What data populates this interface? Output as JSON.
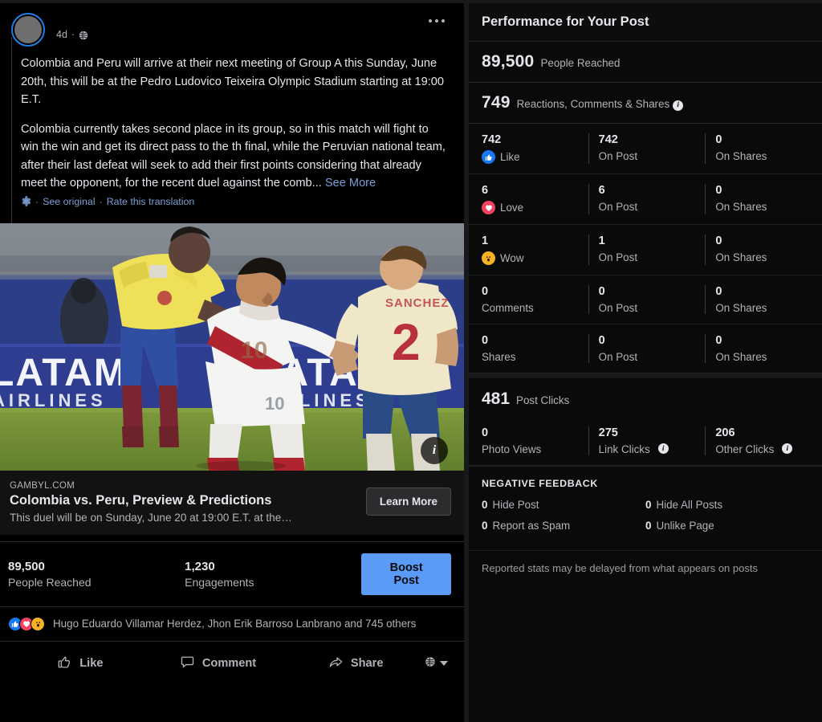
{
  "post": {
    "timestamp": "4d",
    "privacy_icon": "globe-icon",
    "menu_icon": "ellipsis-icon",
    "paragraphs": [
      "Colombia and Peru will arrive at their next meeting of Group A this Sunday, June 20th, this will be at the Pedro Ludovico Teixeira Olympic Stadium starting at 19:00 E.T.",
      "Colombia currently takes second place in its group, so in this match will fight to win the win and get its direct pass to the th final, while the Peruvian national team, after their last defeat will seek to add their first points considering that already meet the opponent, for the recent duel against the comb..."
    ],
    "see_more": "See More",
    "translation": {
      "gear_icon": "gear-icon",
      "separator": "·",
      "see_original": "See original",
      "rate": "Rate this translation"
    },
    "photo": {
      "alt": "Colombia vs Peru football match photo",
      "info_badge": "i",
      "banner_text": "LATAM AIRLINES",
      "jersey_number": "2",
      "jersey_name": "SANCHEZ",
      "peru_number": "10"
    },
    "link_card": {
      "domain": "GAMBYL.COM",
      "title": "Colombia vs. Peru, Preview & Predictions",
      "description": "This duel will be on Sunday, June 20 at 19:00 E.T. at the…",
      "cta": "Learn More"
    },
    "engagement": {
      "reach_value": "89,500",
      "reach_label": "People Reached",
      "engagements_value": "1,230",
      "engagements_label": "Engagements",
      "boost_label": "Boost Post"
    },
    "reactions_summary": {
      "badges": [
        "like-reaction-icon",
        "love-reaction-icon",
        "wow-reaction-icon"
      ],
      "names": "Hugo Eduardo Villamar Herdez, Jhon Erik Barroso Lanbrano and 745 others"
    },
    "actions": [
      {
        "label": "Like",
        "icon": "thumbs-up-icon"
      },
      {
        "label": "Comment",
        "icon": "comment-bubble-icon"
      },
      {
        "label": "Share",
        "icon": "share-arrow-icon"
      }
    ],
    "audience": {
      "icon": "globe-icon",
      "caret": "chevron-down-icon"
    }
  },
  "insights": {
    "title": "Performance for Your Post",
    "summary": [
      {
        "value": "89,500",
        "label": "People Reached",
        "info": false
      },
      {
        "value": "749",
        "label": "Reactions, Comments & Shares",
        "info": true
      }
    ],
    "breakdown_rows": [
      {
        "icon": "like-reaction-icon",
        "total": "742",
        "type": "Like",
        "on_post": "742",
        "on_post_label": "On Post",
        "on_shares": "0",
        "on_shares_label": "On Shares"
      },
      {
        "icon": "love-reaction-icon",
        "total": "6",
        "type": "Love",
        "on_post": "6",
        "on_post_label": "On Post",
        "on_shares": "0",
        "on_shares_label": "On Shares"
      },
      {
        "icon": "wow-reaction-icon",
        "total": "1",
        "type": "Wow",
        "on_post": "1",
        "on_post_label": "On Post",
        "on_shares": "0",
        "on_shares_label": "On Shares"
      },
      {
        "icon": "",
        "total": "0",
        "type": "Comments",
        "on_post": "0",
        "on_post_label": "On Post",
        "on_shares": "0",
        "on_shares_label": "On Shares"
      },
      {
        "icon": "",
        "total": "0",
        "type": "Shares",
        "on_post": "0",
        "on_post_label": "On Post",
        "on_shares": "0",
        "on_shares_label": "On Shares"
      }
    ],
    "clicks": {
      "value": "481",
      "label": "Post Clicks",
      "cells": [
        {
          "value": "0",
          "label": "Photo Views",
          "info": false
        },
        {
          "value": "275",
          "label": "Link Clicks",
          "info": true
        },
        {
          "value": "206",
          "label": "Other Clicks",
          "info": true
        }
      ]
    },
    "negative_feedback": {
      "title": "NEGATIVE FEEDBACK",
      "items": [
        {
          "value": "0",
          "label": "Hide Post"
        },
        {
          "value": "0",
          "label": "Hide All Posts"
        },
        {
          "value": "0",
          "label": "Report as Spam"
        },
        {
          "value": "0",
          "label": "Unlike Page"
        }
      ]
    },
    "footer_note": "Reported stats may be delayed from what appears on posts"
  },
  "colors": {
    "page_bg": "#18191a",
    "card_bg": "#000000",
    "panel_bg": "#0a0a0a",
    "accent_blue": "#5b9bf8",
    "link_blue": "#7b9fd4",
    "text_primary": "#e4e6eb",
    "text_secondary": "#b0b3b8",
    "like_blue": "#1877f2",
    "love_red": "#f3425f",
    "wow_yellow": "#f7b125"
  }
}
